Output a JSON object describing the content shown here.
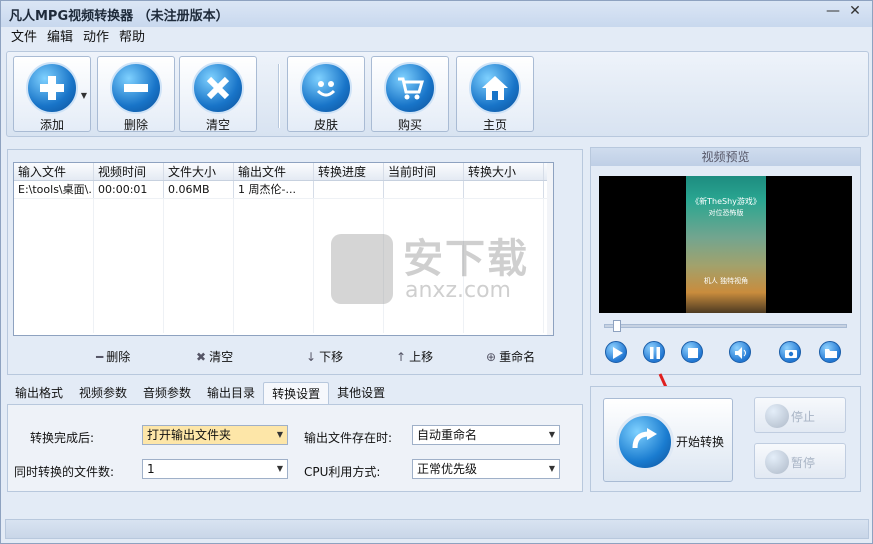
{
  "window": {
    "title": "凡人MPG视频转换器 （未注册版本）",
    "min": "—",
    "close": "✕"
  },
  "menu": [
    "文件",
    "编辑",
    "动作",
    "帮助"
  ],
  "toolbar": {
    "add": "添加",
    "delete": "删除",
    "clear": "清空",
    "skin": "皮肤",
    "buy": "购买",
    "home": "主页"
  },
  "file_list": {
    "headers": [
      "输入文件",
      "视频时间",
      "文件大小",
      "输出文件",
      "转换进度",
      "当前时间",
      "转换大小"
    ],
    "rows": [
      [
        "E:\\tools\\桌面\\...",
        "00:00:01",
        "0.06MB",
        "1 周杰伦-...",
        "",
        "",
        ""
      ]
    ]
  },
  "list_actions": {
    "delete": "删除",
    "clear": "清空",
    "down": "下移",
    "up": "上移",
    "rename": "重命名"
  },
  "tabs": [
    "输出格式",
    "视频参数",
    "音频参数",
    "输出目录",
    "转换设置",
    "其他设置"
  ],
  "active_tab": "转换设置",
  "settings": {
    "after_convert_label": "转换完成后:",
    "after_convert_value": "打开输出文件夹",
    "file_exists_label": "输出文件存在时:",
    "file_exists_value": "自动重命名",
    "concurrent_label": "同时转换的文件数:",
    "concurrent_value": "1",
    "cpu_label": "CPU利用方式:",
    "cpu_value": "正常优先级"
  },
  "preview": {
    "title": "视频预览",
    "frame_text_top": "《新TheShy游戏》",
    "frame_text_sub": "对位恐怖版",
    "frame_text_bottom": "机人 独特视角"
  },
  "convert": {
    "start": "开始转换",
    "stop": "停止",
    "pause": "暂停"
  },
  "watermark": {
    "big": "安下载",
    "small": "anxz.com"
  }
}
